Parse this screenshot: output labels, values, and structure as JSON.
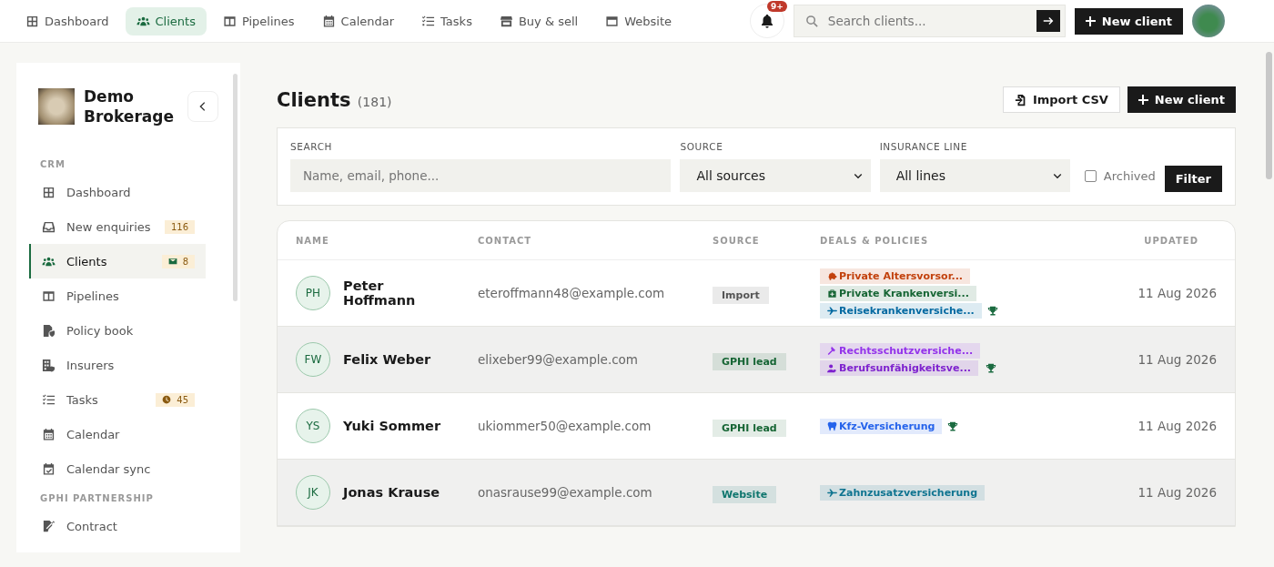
{
  "top_nav": {
    "tabs": [
      {
        "label": "Dashboard",
        "selected": false
      },
      {
        "label": "Clients",
        "selected": true
      },
      {
        "label": "Pipelines",
        "selected": false
      },
      {
        "label": "Calendar",
        "selected": false
      },
      {
        "label": "Tasks",
        "selected": false
      },
      {
        "label": "Buy & sell",
        "selected": false
      },
      {
        "label": "Website",
        "selected": false
      }
    ],
    "notifications": {
      "count": "9+"
    },
    "search": {
      "placeholder": "Search clients..."
    },
    "new_button": "New client"
  },
  "sidebar": {
    "brand": "Demo Brokerage",
    "sections": [
      {
        "title": "CRM",
        "items": [
          {
            "label": "Dashboard",
            "selected": false
          },
          {
            "label": "New enquiries",
            "selected": false,
            "badge": {
              "kind": "plain",
              "text": "116"
            }
          },
          {
            "label": "Clients",
            "selected": true,
            "badge": {
              "kind": "mail",
              "text": "8"
            }
          },
          {
            "label": "Pipelines",
            "selected": false
          },
          {
            "label": "Policy book",
            "selected": false
          },
          {
            "label": "Insurers",
            "selected": false
          },
          {
            "label": "Tasks",
            "selected": false,
            "badge": {
              "kind": "clock",
              "text": "45"
            }
          },
          {
            "label": "Calendar",
            "selected": false
          },
          {
            "label": "Calendar sync",
            "selected": false
          }
        ]
      },
      {
        "title": "GPHI PARTNERSHIP",
        "items": [
          {
            "label": "Contract",
            "selected": false
          }
        ]
      }
    ]
  },
  "page": {
    "title": "Clients",
    "count": "(181)",
    "import_button": "Import CSV",
    "new_button": "New client"
  },
  "filters": {
    "search": {
      "label": "SEARCH",
      "placeholder": "Name, email, phone..."
    },
    "source": {
      "label": "SOURCE",
      "value": "All sources"
    },
    "insurance_line": {
      "label": "INSURANCE LINE",
      "value": "All lines"
    },
    "archived": {
      "label": "Archived",
      "checked": false
    },
    "filter_button": "Filter"
  },
  "table": {
    "columns": [
      "NAME",
      "CONTACT",
      "SOURCE",
      "DEALS & POLICIES",
      "UPDATED"
    ],
    "rows": [
      {
        "initials": "PH",
        "name": "Peter Hoffmann",
        "contact": "eteroffmann48@example.com",
        "source": {
          "label": "Import",
          "color": "#555555"
        },
        "won": true,
        "updated": "11 Aug 2026",
        "deals": [
          {
            "label": "Private Altersvorsor...",
            "color": "#c2410c"
          },
          {
            "label": "Private Krankenversi...",
            "color": "#166534"
          },
          {
            "label": "Reisekrankenversiche...",
            "color": "#0369a1"
          }
        ]
      },
      {
        "initials": "FW",
        "name": "Felix Weber",
        "contact": "elixeber99@example.com",
        "source": {
          "label": "GPHI lead",
          "color": "#166534"
        },
        "won": true,
        "updated": "11 Aug 2026",
        "deals": [
          {
            "label": "Rechtsschutzversiche...",
            "color": "#9333ea"
          },
          {
            "label": "Berufsunfähigkeitsve...",
            "color": "#7e22ce"
          }
        ]
      },
      {
        "initials": "YS",
        "name": "Yuki Sommer",
        "contact": "ukiommer50@example.com",
        "source": {
          "label": "GPHI lead",
          "color": "#166534"
        },
        "won": true,
        "updated": "11 Aug 2026",
        "deals": [
          {
            "label": "Kfz-Versicherung",
            "color": "#2563eb"
          }
        ]
      },
      {
        "initials": "JK",
        "name": "Jonas Krause",
        "contact": "onasrause99@example.com",
        "source": {
          "label": "Website",
          "color": "#0f766e"
        },
        "won": false,
        "updated": "11 Aug 2026",
        "deals": [
          {
            "label": "Zahnzusatzversicherung",
            "color": "#0e7490"
          }
        ]
      }
    ]
  }
}
